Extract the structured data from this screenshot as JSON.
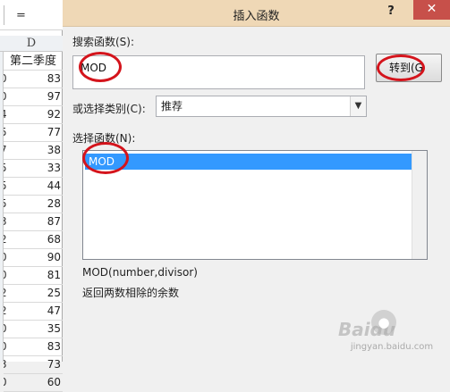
{
  "spreadsheet": {
    "formula_symbol": "=",
    "column_letter": "D",
    "header_cell": "第二季度",
    "rows": [
      {
        "lead": "0",
        "value": "83"
      },
      {
        "lead": "0",
        "value": "97"
      },
      {
        "lead": "4",
        "value": "92"
      },
      {
        "lead": "5",
        "value": "77"
      },
      {
        "lead": "7",
        "value": "38"
      },
      {
        "lead": "5",
        "value": "33"
      },
      {
        "lead": "5",
        "value": "44"
      },
      {
        "lead": "5",
        "value": "28"
      },
      {
        "lead": "3",
        "value": "87"
      },
      {
        "lead": "2",
        "value": "68"
      },
      {
        "lead": "0",
        "value": "90"
      },
      {
        "lead": "0",
        "value": "81"
      },
      {
        "lead": "2",
        "value": "25"
      },
      {
        "lead": "2",
        "value": "47"
      },
      {
        "lead": "0",
        "value": "35"
      },
      {
        "lead": "0",
        "value": "83"
      },
      {
        "lead": "3",
        "value": "73"
      },
      {
        "lead": "0",
        "value": "60"
      }
    ]
  },
  "dialog": {
    "title": "插入函数",
    "help_label": "?",
    "close_label": "✕",
    "search_label": "搜索函数(S):",
    "search_value": "MOD",
    "go_button": "转到(G",
    "category_label": "或选择类别(C):",
    "category_value": "推荐",
    "function_list_label": "选择函数(N):",
    "functions": [
      "MOD"
    ],
    "signature": "MOD(number,divisor)",
    "description": "返回两数相除的余数"
  },
  "colors": {
    "titlebar": "#efd8b6",
    "close_button": "#c7504a",
    "selection": "#3399ff",
    "annotation": "#d4141c"
  },
  "watermark": {
    "logo": "Baidu",
    "caption": "jingyan.baidu.com"
  }
}
